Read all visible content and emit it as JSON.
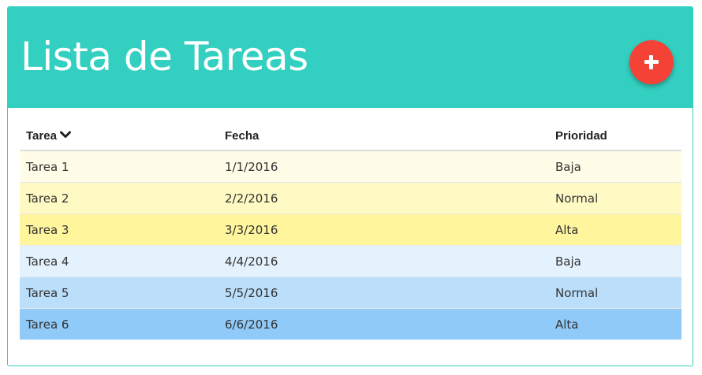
{
  "header": {
    "title": "Lista de Tareas",
    "add_button_icon": "plus-icon",
    "accent_color": "#33cfc0",
    "fab_color": "#f44336"
  },
  "table": {
    "columns": [
      "Tarea",
      "Fecha",
      "Prioridad"
    ],
    "sort_icon": "chevron-down-icon",
    "rows": [
      {
        "tarea": "Tarea 1",
        "fecha": "1/1/2016",
        "prioridad": "Baja"
      },
      {
        "tarea": "Tarea 2",
        "fecha": "2/2/2016",
        "prioridad": "Normal"
      },
      {
        "tarea": "Tarea 3",
        "fecha": "3/3/2016",
        "prioridad": "Alta"
      },
      {
        "tarea": "Tarea 4",
        "fecha": "4/4/2016",
        "prioridad": "Baja"
      },
      {
        "tarea": "Tarea 5",
        "fecha": "5/5/2016",
        "prioridad": "Normal"
      },
      {
        "tarea": "Tarea 6",
        "fecha": "6/6/2016",
        "prioridad": "Alta"
      }
    ]
  }
}
